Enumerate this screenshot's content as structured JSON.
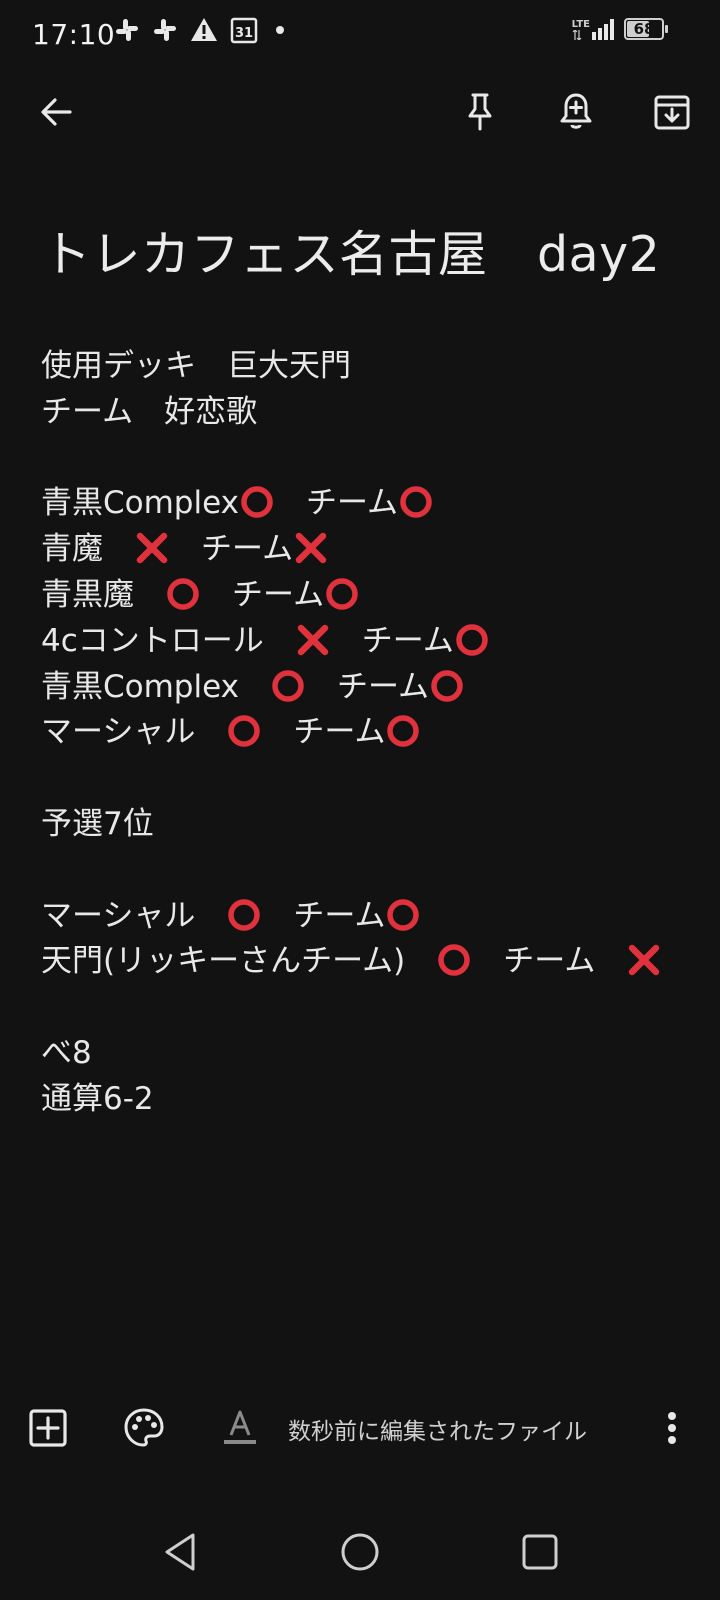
{
  "status_bar": {
    "time": "17:10",
    "notification_icons": [
      "slack-icon",
      "slack-icon",
      "warning-icon",
      "calendar-icon",
      "dot-icon"
    ],
    "calendar_day": "31",
    "network": "LTE",
    "battery": "68"
  },
  "app_bar": {
    "icons": [
      "back-arrow-icon",
      "pin-icon",
      "reminder-bell-icon",
      "archive-icon"
    ]
  },
  "note": {
    "title": "トレカフェス名古屋　day2",
    "lines": [
      [
        {
          "t": "使用デッキ　巨大天門"
        }
      ],
      [
        {
          "t": "チーム　好恋歌"
        }
      ],
      [],
      [
        {
          "t": "青黒Complex"
        },
        {
          "m": "o"
        },
        {
          "t": "　チーム"
        },
        {
          "m": "o"
        }
      ],
      [
        {
          "t": "青魔　"
        },
        {
          "m": "x"
        },
        {
          "t": "　チーム"
        },
        {
          "m": "x"
        }
      ],
      [
        {
          "t": "青黒魔　"
        },
        {
          "m": "o"
        },
        {
          "t": "　チーム"
        },
        {
          "m": "o"
        }
      ],
      [
        {
          "t": "4cコントロール　"
        },
        {
          "m": "x"
        },
        {
          "t": "　チーム"
        },
        {
          "m": "o"
        }
      ],
      [
        {
          "t": "青黒Complex　"
        },
        {
          "m": "o"
        },
        {
          "t": "　チーム"
        },
        {
          "m": "o"
        }
      ],
      [
        {
          "t": "マーシャル　"
        },
        {
          "m": "o"
        },
        {
          "t": "　チーム"
        },
        {
          "m": "o"
        }
      ],
      [],
      [
        {
          "t": "予選7位"
        }
      ],
      [],
      [
        {
          "t": "マーシャル　"
        },
        {
          "m": "o"
        },
        {
          "t": "　チーム"
        },
        {
          "m": "o"
        }
      ],
      [
        {
          "t": "天門(リッキーさんチーム)　"
        },
        {
          "m": "o"
        },
        {
          "t": "　チーム　"
        },
        {
          "m": "x"
        }
      ],
      [],
      [
        {
          "t": "べ8"
        }
      ],
      [
        {
          "t": "通算6-2"
        }
      ]
    ]
  },
  "bottom_toolbar": {
    "edited_label": "数秒前に編集されたファイル",
    "icons": [
      "add-box-icon",
      "palette-icon",
      "text-format-icon",
      "more-vert-icon"
    ]
  },
  "colors": {
    "background": "#121212",
    "text": "#e8e8e8",
    "mark_red": "#e0323c"
  }
}
